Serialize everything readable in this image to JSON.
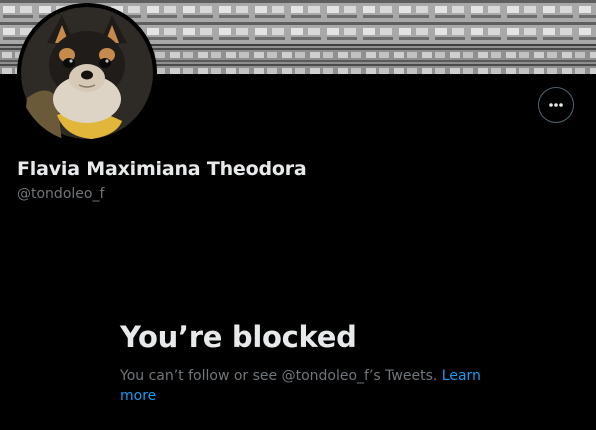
{
  "profile": {
    "display_name": "Flavia Maximiana Theodora",
    "handle": "@tondoleo_f"
  },
  "blocked": {
    "title": "You’re blocked",
    "message": "You can’t follow or see @tondoleo_f’s Tweets.",
    "link_label": "Learn more"
  },
  "icons": {
    "more": "more-horizontal-icon"
  },
  "colors": {
    "background": "#000000",
    "primary_text": "#e7e9ea",
    "secondary_text": "#71767b",
    "link": "#1d9bf0",
    "border": "#536471"
  }
}
